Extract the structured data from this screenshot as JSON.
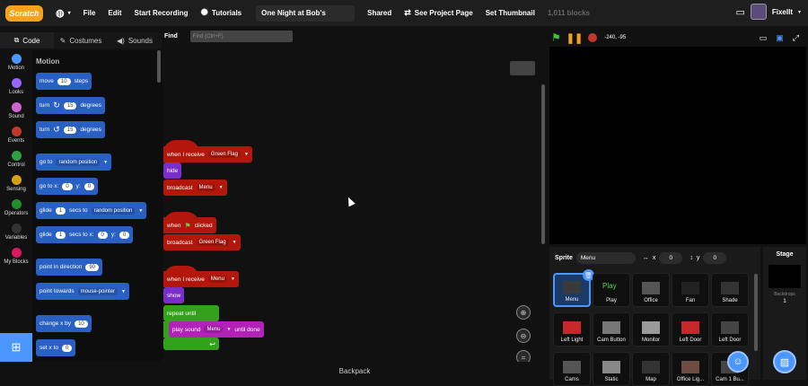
{
  "topbar": {
    "logo": "Scratch",
    "file": "File",
    "edit": "Edit",
    "record": "Start Recording",
    "tutorials": "Tutorials",
    "project_title": "One Night at Bob's",
    "shared": "Shared",
    "see_project": "See Project Page",
    "set_thumbnail": "Set Thumbnail",
    "block_count": "1,011 blocks",
    "username": "FixelIt"
  },
  "tabs": {
    "code": "Code",
    "costumes": "Costumes",
    "sounds": "Sounds"
  },
  "categories": [
    {
      "label": "Motion",
      "color": "#4c97ff"
    },
    {
      "label": "Looks",
      "color": "#9966ff"
    },
    {
      "label": "Sound",
      "color": "#cf63cf"
    },
    {
      "label": "Events",
      "color": "#c0392b"
    },
    {
      "label": "Control",
      "color": "#2ea043"
    },
    {
      "label": "Sensing",
      "color": "#d4a017"
    },
    {
      "label": "Operators",
      "color": "#1f8f2d"
    },
    {
      "label": "Variables",
      "color": "#333333"
    },
    {
      "label": "My Blocks",
      "color": "#d81b60"
    }
  ],
  "palette": {
    "heading": "Motion",
    "move": "move",
    "move_val": "10",
    "steps": "steps",
    "turn": "turn",
    "turn_r_val": "15",
    "turn_l_val": "15",
    "degrees": "degrees",
    "goto": "go to",
    "goto_dd": "random position",
    "goto_xy": "go to x:",
    "gx": "0",
    "y": "y:",
    "gy": "0",
    "glide": "glide",
    "glide1": "1",
    "secs_to": "secs to",
    "glide_dd": "random position",
    "glide2": "1",
    "secs_to_x": "secs to x:",
    "glx": "0",
    "gly": "0",
    "point_dir": "point in direction",
    "dir_val": "90",
    "point_towards": "point towards",
    "towards_dd": "mouse-pointer",
    "change_x": "change x by",
    "change_x_val": "10",
    "set_x": "set x to",
    "set_x_val": "0"
  },
  "find": {
    "label": "Find",
    "placeholder": "Find (Ctrl+F)"
  },
  "scripts": {
    "s1_hat": "when I receive",
    "s1_msg": "Green Flag",
    "s1_hide": "hide",
    "s1_broadcast": "broadcast",
    "s1_bmsg": "Menu",
    "s2_hat": "when",
    "s2_clicked": "clicked",
    "s2_broadcast": "broadcast",
    "s2_bmsg": "Green Flag",
    "s3_hat": "when I receive",
    "s3_msg": "Menu",
    "s3_show": "show",
    "s3_repeat": "repeat until",
    "s3_play": "play sound",
    "s3_sound": "Menu",
    "s3_until": "until done"
  },
  "backpack": "Backpack",
  "stage": {
    "coords": "-240, -95"
  },
  "sprite_info": {
    "sprite_label": "Sprite",
    "sprite_name": "Menu",
    "x_label": "x",
    "x_val": "0",
    "y_label": "y",
    "y_val": "0"
  },
  "sprites": [
    "Menu",
    "Play",
    "Office",
    "Fan",
    "Shade",
    "Left Light",
    "Cam Button",
    "Monitor",
    "Left Door",
    "Left Door",
    "Cams",
    "Static",
    "Map",
    "Office Lig...",
    "Cam 1 Bu..."
  ],
  "play_thumb": "Play",
  "stage_pane": {
    "label": "Stage",
    "backdrops_label": "Backdrops",
    "backdrops_count": "1"
  }
}
